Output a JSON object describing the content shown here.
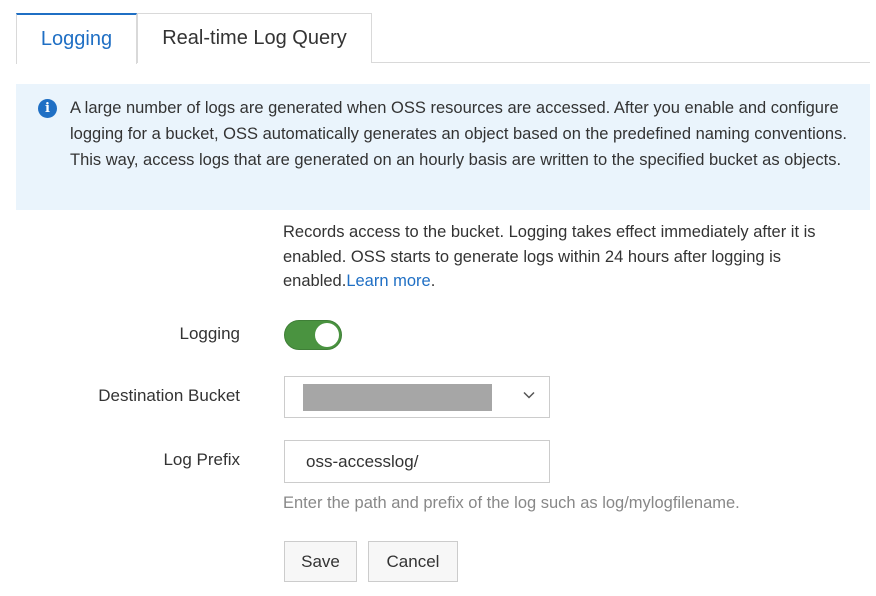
{
  "tabs": [
    {
      "label": "Logging",
      "active": true
    },
    {
      "label": "Real-time Log Query",
      "active": false
    }
  ],
  "notice": {
    "icon": "info-icon",
    "text": "A large number of logs are generated when OSS resources are accessed. After you enable and configure logging for a bucket, OSS automatically generates an object based on the predefined naming conventions. This way, access logs that are generated on an hourly basis are written to the specified bucket as objects."
  },
  "description": {
    "text": "Records access to the bucket. Logging takes effect immediately after it is enabled. OSS starts to generate logs within 24 hours after logging is enabled.",
    "link_label": "Learn more",
    "suffix": "."
  },
  "form": {
    "logging_label": "Logging",
    "logging_enabled": true,
    "destination_label": "Destination Bucket",
    "destination_value_redacted": true,
    "prefix_label": "Log Prefix",
    "prefix_value": "oss-accesslog/",
    "prefix_hint": "Enter the path and prefix of the log such as log/mylogfilename."
  },
  "buttons": {
    "save": "Save",
    "cancel": "Cancel"
  },
  "colors": {
    "accent": "#1f6fc4",
    "toggle_on": "#4a9340",
    "notice_bg": "#eaf4fc"
  }
}
